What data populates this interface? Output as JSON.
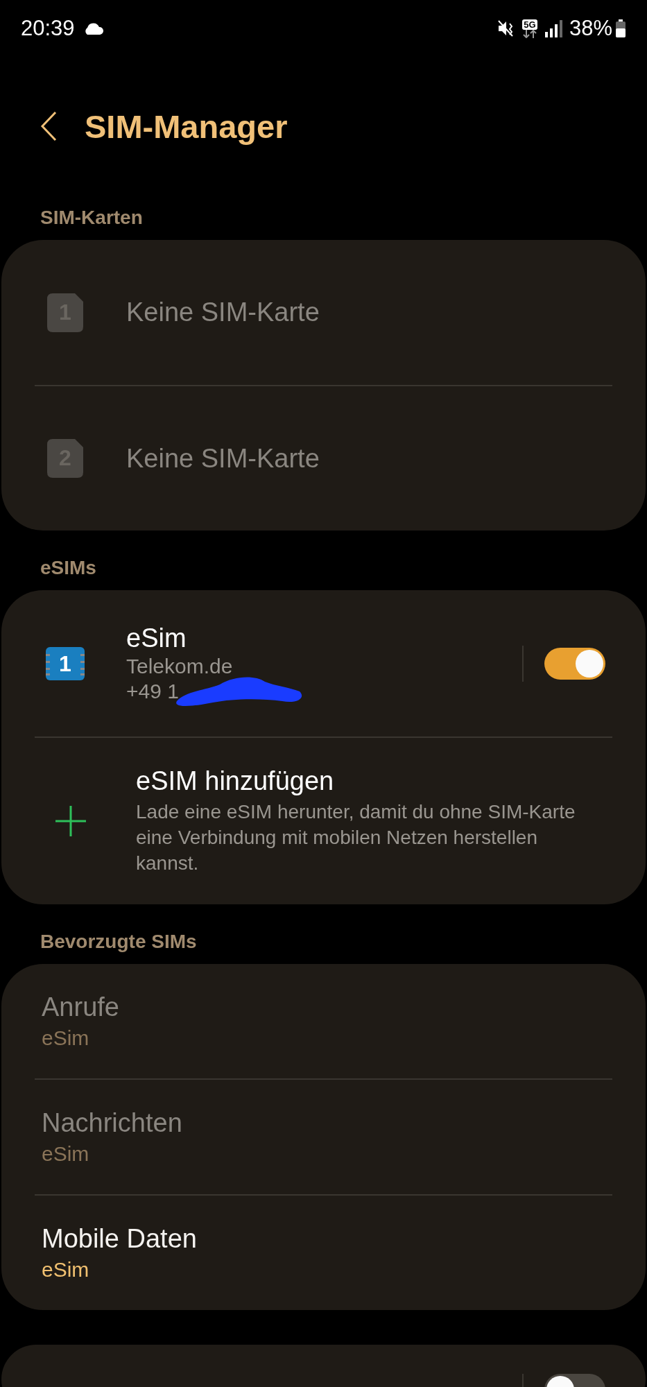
{
  "status_bar": {
    "time": "20:39",
    "battery": "38%",
    "network": "5G"
  },
  "header": {
    "title": "SIM-Manager"
  },
  "sim_cards": {
    "heading": "SIM-Karten",
    "items": [
      {
        "slot": "1",
        "label": "Keine SIM-Karte",
        "disabled": true
      },
      {
        "slot": "2",
        "label": "Keine SIM-Karte",
        "disabled": true
      }
    ]
  },
  "esims": {
    "heading": "eSIMs",
    "items": [
      {
        "slot": "1",
        "name": "eSim",
        "carrier": "Telekom.de",
        "number": "+49 1",
        "on": true
      }
    ],
    "add": {
      "title": "eSIM hinzufügen",
      "description": "Lade eine eSIM herunter, damit du ohne SIM-Karte eine Verbindung mit mobilen Netzen herstellen kannst."
    }
  },
  "preferred": {
    "heading": "Bevorzugte SIMs",
    "items": [
      {
        "label": "Anrufe",
        "value": "eSim",
        "disabled": true
      },
      {
        "label": "Nachrichten",
        "value": "eSim",
        "disabled": true
      },
      {
        "label": "Mobile Daten",
        "value": "eSim",
        "disabled": false
      }
    ]
  },
  "bottom_card": {
    "toggle_on": false
  }
}
